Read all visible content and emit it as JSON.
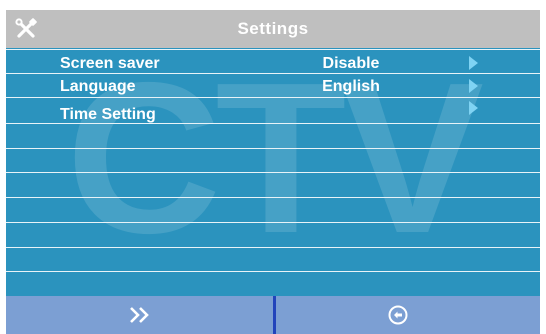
{
  "header": {
    "title": "Settings",
    "icon": "tools-icon"
  },
  "watermark": {
    "text": "CTV"
  },
  "menu": {
    "items": [
      {
        "label": "Screen saver",
        "value": "Disable",
        "icon": "arrow-right-icon"
      },
      {
        "label": "Language",
        "value": "English",
        "icon": "arrow-right-icon"
      },
      {
        "label": "Time Setting",
        "value": "",
        "icon": "arrow-right-icon"
      }
    ]
  },
  "footer": {
    "next_icon": "double-chevron-right-icon",
    "back_icon": "return-icon"
  },
  "colors": {
    "background": "#2b93be",
    "titlebar": "#bfbfbf",
    "footer": "#7c9fd3",
    "arrow": "#7fd3f3",
    "divider": "#2244bb"
  }
}
